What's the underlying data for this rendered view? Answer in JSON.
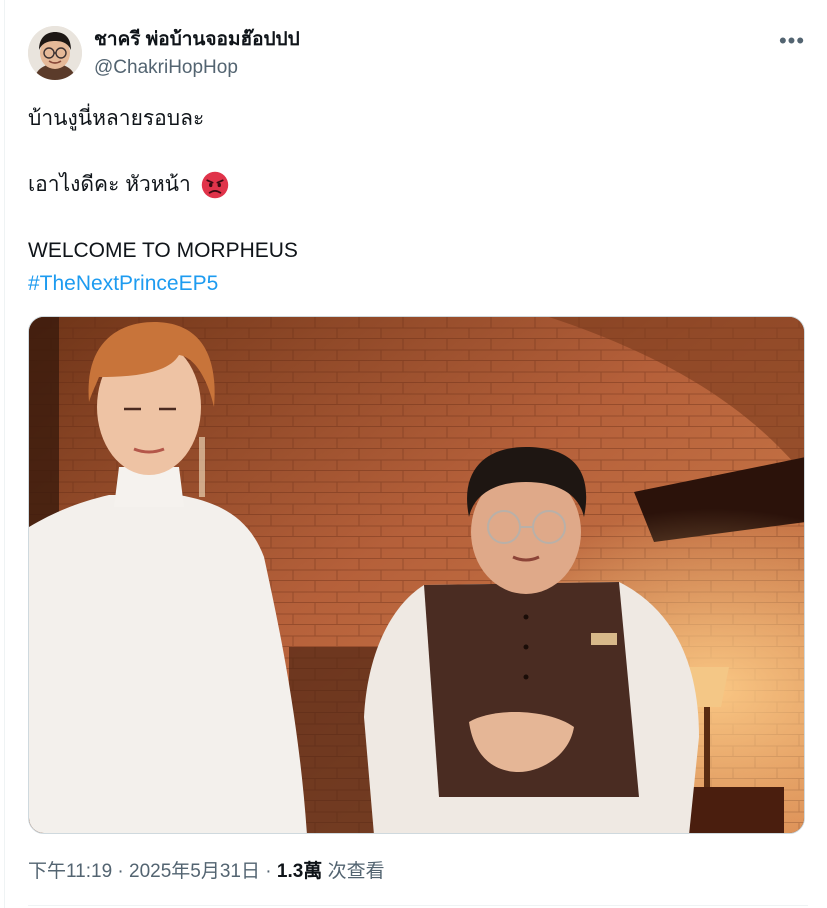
{
  "author": {
    "display_name": "ชาครี พ่อบ้านจอมฮ๊อปปป",
    "handle": "@ChakriHopHop",
    "avatar_icon": "avatar-portrait",
    "more_icon": "more-icon",
    "more_glyph": "•••"
  },
  "tweet": {
    "lines": [
      "บ้านงูนี่หลายรอบละ",
      "",
      "เอาไงดีคะ หัวหน้า",
      "",
      "WELCOME TO MORPHEUS"
    ],
    "emoji": "angry-face-emoji",
    "hashtag": "#TheNextPrinceEP5"
  },
  "meta": {
    "time": "下午11:19",
    "separator1": " · ",
    "date": "2025年5月31日",
    "separator2": " · ",
    "views_count": "1.3萬",
    "views_label": " 次查看"
  },
  "colors": {
    "link": "#1d9bf0",
    "secondary_text": "#536471",
    "primary_text": "#0f1419",
    "border": "#cfd9de"
  }
}
